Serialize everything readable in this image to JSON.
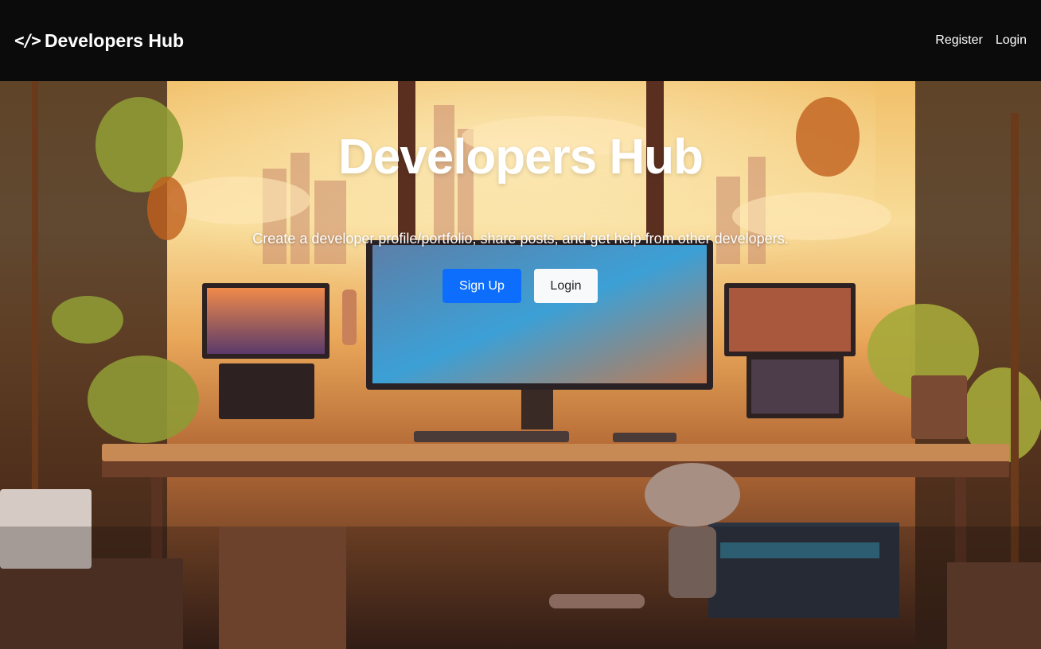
{
  "navbar": {
    "brand_icon": "</>",
    "brand_text": "Developers Hub",
    "links": [
      {
        "label": "Register"
      },
      {
        "label": "Login"
      }
    ]
  },
  "hero": {
    "title": "Developers Hub",
    "lead": "Create a developer profile/portfolio, share posts, and get help from other developers.",
    "signup_label": "Sign Up",
    "login_label": "Login",
    "background_image": "cozy-developer-workspace-illustration"
  },
  "colors": {
    "navbar_bg": "#0b0b0b",
    "primary": "#0d6efd",
    "light_button": "#f8f9fa",
    "text_light": "#ffffff"
  }
}
